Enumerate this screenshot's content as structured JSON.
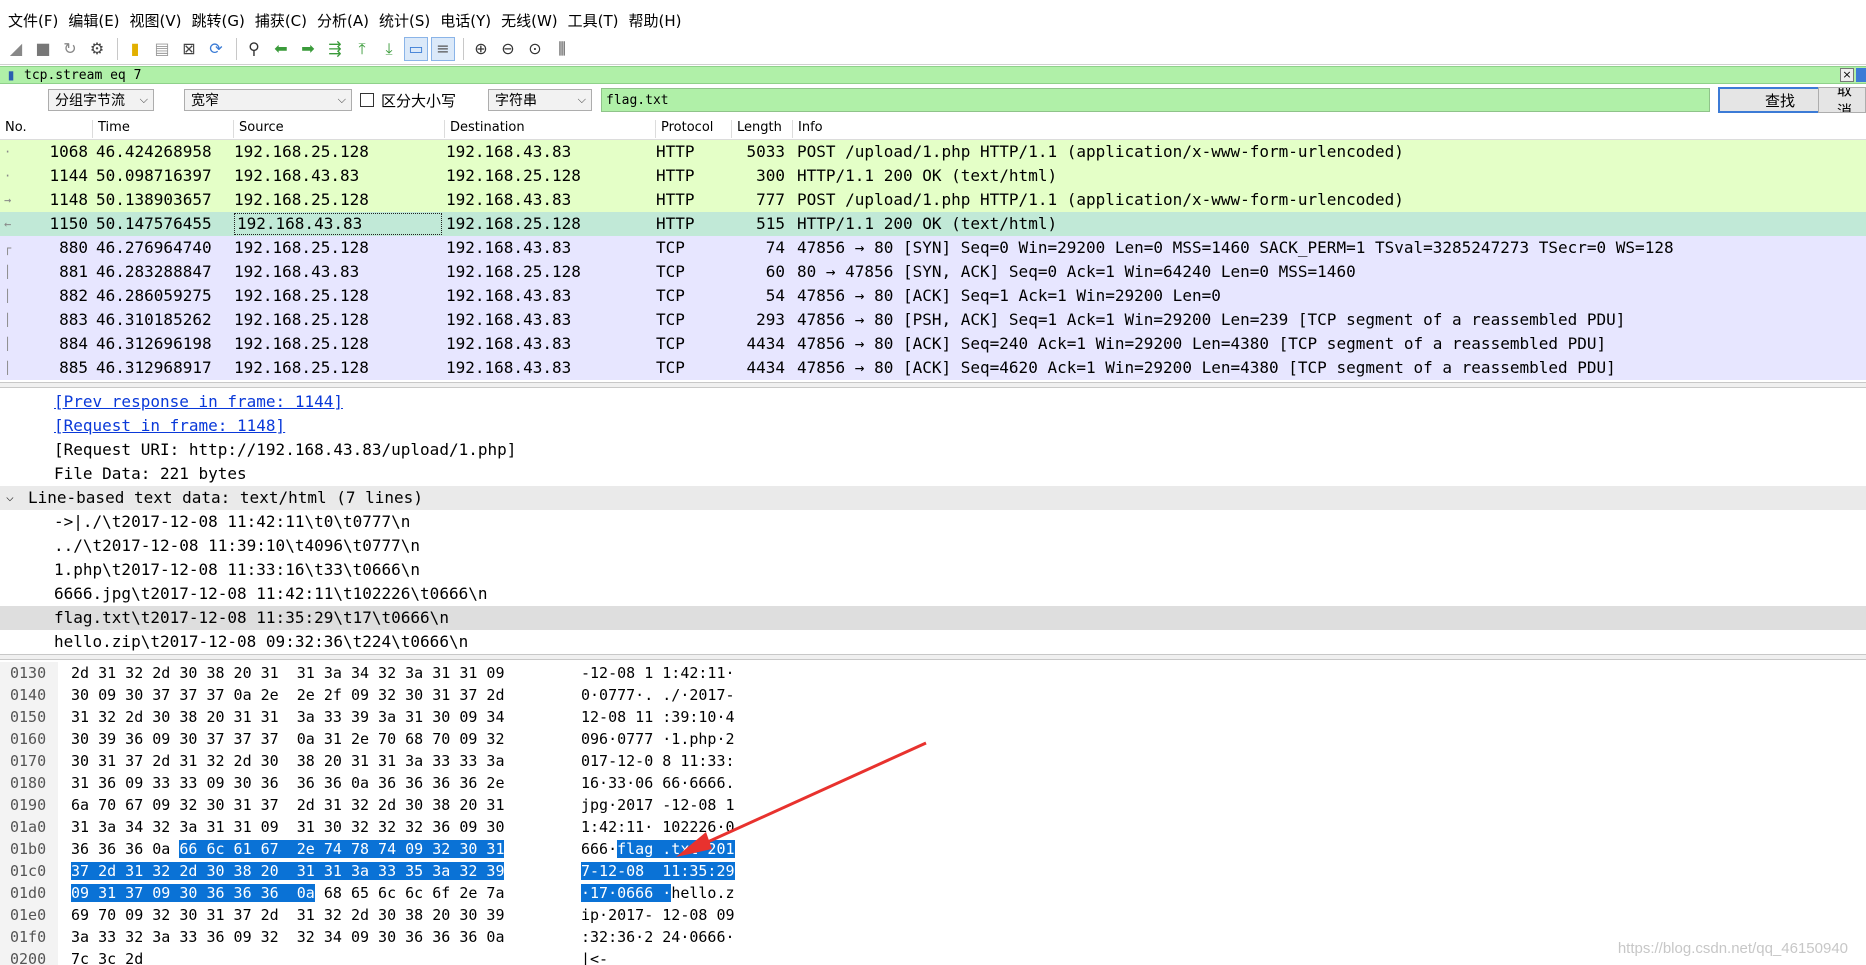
{
  "menu": [
    "文件(F)",
    "编辑(E)",
    "视图(V)",
    "跳转(G)",
    "捕获(C)",
    "分析(A)",
    "统计(S)",
    "电话(Y)",
    "无线(W)",
    "工具(T)",
    "帮助(H)"
  ],
  "filter": {
    "value": "tcp.stream eq 7"
  },
  "find": {
    "scope": "分组字节流",
    "charset": "宽窄",
    "case_label": "区分大小写",
    "type": "字符串",
    "query": "flag.txt",
    "find_button": "查找",
    "cancel_button": "取消"
  },
  "packet_list": {
    "columns": [
      "No.",
      "Time",
      "Source",
      "Destination",
      "Protocol",
      "Length",
      "Info"
    ],
    "rows": [
      {
        "no": "1068",
        "time": "46.424268958",
        "src": "192.168.25.128",
        "dst": "192.168.43.83",
        "proto": "HTTP",
        "len": "5033",
        "info": "POST /upload/1.php HTTP/1.1  (application/x-www-form-urlencoded)",
        "kind": "http",
        "selected": false,
        "mark": "·"
      },
      {
        "no": "1144",
        "time": "50.098716397",
        "src": "192.168.43.83",
        "dst": "192.168.25.128",
        "proto": "HTTP",
        "len": "300",
        "info": "HTTP/1.1 200 OK  (text/html)",
        "kind": "http",
        "selected": false,
        "mark": "·"
      },
      {
        "no": "1148",
        "time": "50.138903657",
        "src": "192.168.25.128",
        "dst": "192.168.43.83",
        "proto": "HTTP",
        "len": "777",
        "info": "POST /upload/1.php HTTP/1.1  (application/x-www-form-urlencoded)",
        "kind": "http",
        "selected": false,
        "mark": "→"
      },
      {
        "no": "1150",
        "time": "50.147576455",
        "src": "192.168.43.83",
        "dst": "192.168.25.128",
        "proto": "HTTP",
        "len": "515",
        "info": "HTTP/1.1 200 OK  (text/html)",
        "kind": "http",
        "selected": true,
        "mark": "←"
      },
      {
        "no": "880",
        "time": "46.276964740",
        "src": "192.168.25.128",
        "dst": "192.168.43.83",
        "proto": "TCP",
        "len": "74",
        "info": "47856 → 80 [SYN] Seq=0 Win=29200 Len=0 MSS=1460 SACK_PERM=1 TSval=3285247273 TSecr=0 WS=128",
        "kind": "tcp",
        "selected": false,
        "mark": "┌"
      },
      {
        "no": "881",
        "time": "46.283288847",
        "src": "192.168.43.83",
        "dst": "192.168.25.128",
        "proto": "TCP",
        "len": "60",
        "info": "80 → 47856 [SYN, ACK] Seq=0 Ack=1 Win=64240 Len=0 MSS=1460",
        "kind": "tcp",
        "selected": false,
        "mark": "│"
      },
      {
        "no": "882",
        "time": "46.286059275",
        "src": "192.168.25.128",
        "dst": "192.168.43.83",
        "proto": "TCP",
        "len": "54",
        "info": "47856 → 80 [ACK] Seq=1 Ack=1 Win=29200 Len=0",
        "kind": "tcp",
        "selected": false,
        "mark": "│"
      },
      {
        "no": "883",
        "time": "46.310185262",
        "src": "192.168.25.128",
        "dst": "192.168.43.83",
        "proto": "TCP",
        "len": "293",
        "info": "47856 → 80 [PSH, ACK] Seq=1 Ack=1 Win=29200 Len=239 [TCP segment of a reassembled PDU]",
        "kind": "tcp",
        "selected": false,
        "mark": "│"
      },
      {
        "no": "884",
        "time": "46.312696198",
        "src": "192.168.25.128",
        "dst": "192.168.43.83",
        "proto": "TCP",
        "len": "4434",
        "info": "47856 → 80 [ACK] Seq=240 Ack=1 Win=29200 Len=4380 [TCP segment of a reassembled PDU]",
        "kind": "tcp",
        "selected": false,
        "mark": "│"
      },
      {
        "no": "885",
        "time": "46.312968917",
        "src": "192.168.25.128",
        "dst": "192.168.43.83",
        "proto": "TCP",
        "len": "4434",
        "info": "47856 → 80 [ACK] Seq=4620 Ack=1 Win=29200 Len=4380 [TCP segment of a reassembled PDU]",
        "kind": "tcp",
        "selected": false,
        "mark": "│"
      }
    ]
  },
  "details": {
    "prev_response": "[Prev response in frame: 1144]",
    "request_frame": "[Request in frame: 1148]",
    "request_uri": "[Request URI: http://192.168.43.83/upload/1.php]",
    "file_data": "File Data: 221 bytes",
    "section": "Line-based text data: text/html (7 lines)",
    "lines": [
      "->|./\\t2017-12-08 11:42:11\\t0\\t0777\\n",
      "../\\t2017-12-08 11:39:10\\t4096\\t0777\\n",
      "1.php\\t2017-12-08 11:33:16\\t33\\t0666\\n",
      "6666.jpg\\t2017-12-08 11:42:11\\t102226\\t0666\\n",
      "flag.txt\\t2017-12-08 11:35:29\\t17\\t0666\\n",
      "hello.zip\\t2017-12-08 09:32:36\\t224\\t0666\\n"
    ],
    "highlighted_line": 4
  },
  "hex": {
    "rows": [
      {
        "offset": "0130",
        "bytes_pre": "2d 31 32 2d 30 38 20 31  31 3a 34 32 3a 31 31 09",
        "bytes_sel": "",
        "bytes_post": "",
        "ascii_pre": "-12-08 1 1:42:11·",
        "ascii_sel": "",
        "ascii_post": ""
      },
      {
        "offset": "0140",
        "bytes_pre": "30 09 30 37 37 37 0a 2e  2e 2f 09 32 30 31 37 2d",
        "bytes_sel": "",
        "bytes_post": "",
        "ascii_pre": "0·0777·. ./·2017-",
        "ascii_sel": "",
        "ascii_post": ""
      },
      {
        "offset": "0150",
        "bytes_pre": "31 32 2d 30 38 20 31 31  3a 33 39 3a 31 30 09 34",
        "bytes_sel": "",
        "bytes_post": "",
        "ascii_pre": "12-08 11 :39:10·4",
        "ascii_sel": "",
        "ascii_post": ""
      },
      {
        "offset": "0160",
        "bytes_pre": "30 39 36 09 30 37 37 37  0a 31 2e 70 68 70 09 32",
        "bytes_sel": "",
        "bytes_post": "",
        "ascii_pre": "096·0777 ·1.php·2",
        "ascii_sel": "",
        "ascii_post": ""
      },
      {
        "offset": "0170",
        "bytes_pre": "30 31 37 2d 31 32 2d 30  38 20 31 31 3a 33 33 3a",
        "bytes_sel": "",
        "bytes_post": "",
        "ascii_pre": "017-12-0 8 11:33:",
        "ascii_sel": "",
        "ascii_post": ""
      },
      {
        "offset": "0180",
        "bytes_pre": "31 36 09 33 33 09 30 36  36 36 0a 36 36 36 36 2e",
        "bytes_sel": "",
        "bytes_post": "",
        "ascii_pre": "16·33·06 66·6666.",
        "ascii_sel": "",
        "ascii_post": ""
      },
      {
        "offset": "0190",
        "bytes_pre": "6a 70 67 09 32 30 31 37  2d 31 32 2d 30 38 20 31",
        "bytes_sel": "",
        "bytes_post": "",
        "ascii_pre": "jpg·2017 -12-08 1",
        "ascii_sel": "",
        "ascii_post": ""
      },
      {
        "offset": "01a0",
        "bytes_pre": "31 3a 34 32 3a 31 31 09  31 30 32 32 32 36 09 30",
        "bytes_sel": "",
        "bytes_post": "",
        "ascii_pre": "1:42:11· 102226·0",
        "ascii_sel": "",
        "ascii_post": ""
      },
      {
        "offset": "01b0",
        "bytes_pre": "36 36 36 0a ",
        "bytes_sel": "66 6c 61 67  2e 74 78 74 09 32 30 31",
        "bytes_post": "",
        "ascii_pre": "666·",
        "ascii_sel": "flag .txt·201",
        "ascii_post": ""
      },
      {
        "offset": "01c0",
        "bytes_pre": "",
        "bytes_sel": "37 2d 31 32 2d 30 38 20  31 31 3a 33 35 3a 32 39",
        "bytes_post": "",
        "ascii_pre": "",
        "ascii_sel": "7-12-08  11:35:29",
        "ascii_post": ""
      },
      {
        "offset": "01d0",
        "bytes_pre": "",
        "bytes_sel": "09 31 37 09 30 36 36 36  0a",
        "bytes_post": " 68 65 6c 6c 6f 2e 7a",
        "ascii_pre": "",
        "ascii_sel": "·17·0666 ·",
        "ascii_post": "hello.z"
      },
      {
        "offset": "01e0",
        "bytes_pre": "69 70 09 32 30 31 37 2d  31 32 2d 30 38 20 30 39",
        "bytes_sel": "",
        "bytes_post": "",
        "ascii_pre": "ip·2017- 12-08 09",
        "ascii_sel": "",
        "ascii_post": ""
      },
      {
        "offset": "01f0",
        "bytes_pre": "3a 33 32 3a 33 36 09 32  32 34 09 30 36 36 36 0a",
        "bytes_sel": "",
        "bytes_post": "",
        "ascii_pre": ":32:36·2 24·0666·",
        "ascii_sel": "",
        "ascii_post": ""
      },
      {
        "offset": "0200",
        "bytes_pre": "7c 3c 2d",
        "bytes_sel": "",
        "bytes_post": "",
        "ascii_pre": "|<-",
        "ascii_sel": "",
        "ascii_post": ""
      }
    ]
  },
  "watermark": "https://blog.csdn.net/qq_46150940",
  "colors": {
    "http_row": "#e4ffc7",
    "tcp_row": "#e7e6ff",
    "selected_row": "#c1e9d7",
    "filter_bg": "#b0f0a8",
    "hex_selection": "#0a72d6",
    "arrow": "#e8322e"
  }
}
